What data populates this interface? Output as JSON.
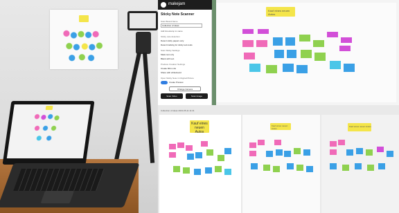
{
  "photo": {
    "caption": ""
  },
  "scanner_app": {
    "brand": "makejam",
    "title": "Sticky Note Scanner",
    "board_name_label": "Scan Board Name",
    "board_name_value": "Collection of ideas",
    "add_timestamp_label": "Add timestamp to name",
    "detection_label": "Sticky note detection",
    "detection_options": [
      "Detect sticky papers only",
      "Detect tracking for sticky text-tools"
    ],
    "color_label": "Scan Sticky Settings",
    "color_options": [
      "Mask text only",
      "Blank with text"
    ],
    "export_label": "Produce Creation Settings",
    "export_options": [
      "Create Miro Link",
      "Share with whiteboard"
    ],
    "preview_label": "Open Sticky Note in Original Picture",
    "preview_toggle": "Create Preview",
    "change_camera": "Change Camera",
    "scan_video": "Scan Video",
    "scan_image": "Scan Image"
  },
  "board_header": {
    "top_note": "Kauf eines neuen Autos",
    "scan_caption": "Collection of ideas 2023-05-11 11:41"
  },
  "bottom_panels": [
    {
      "note": "Kauf eines neuen Autos"
    },
    {
      "note": "Kauf eines neuen Autos"
    },
    {
      "note": "Kauf eines neuen Autos"
    }
  ],
  "colors": {
    "green_wall": "#6b8f6c",
    "yellow": "#f4e54a",
    "pink": "#f06ab8",
    "magenta": "#d24fd8",
    "blue": "#3aa0e6",
    "green": "#8fd14f",
    "cyan": "#4ac6e8"
  }
}
